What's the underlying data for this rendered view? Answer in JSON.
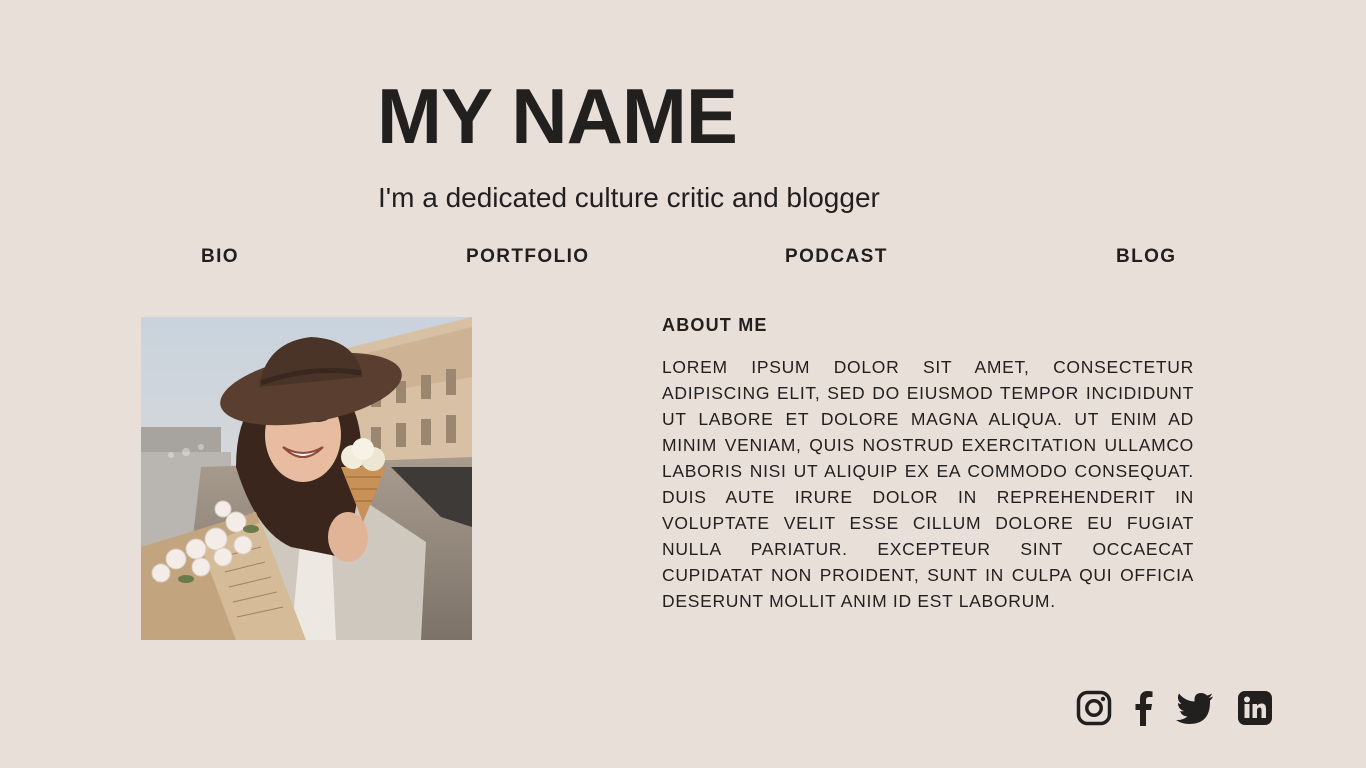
{
  "header": {
    "name": "MY NAME",
    "tagline": "I'm a dedicated culture critic and blogger"
  },
  "nav": {
    "items": [
      {
        "label": "BIO"
      },
      {
        "label": "PORTFOLIO"
      },
      {
        "label": "PODCAST"
      },
      {
        "label": "BLOG"
      }
    ]
  },
  "profile_photo": {
    "subject": "smiling woman in a brown wide-brim hat holding a flower bouquet and an ice cream cone on a city street"
  },
  "about": {
    "heading": "ABOUT ME",
    "body": "LOREM IPSUM DOLOR SIT AMET, CONSECTETUR ADIPISCING ELIT, SED DO EIUSMOD TEMPOR INCIDIDUNT UT LABORE ET DOLORE MAGNA ALIQUA. UT ENIM AD MINIM VENIAM, QUIS NOSTRUD EXERCITATION ULLAMCO LABORIS NISI UT ALIQUIP EX EA COMMODO CONSEQUAT. DUIS AUTE IRURE DOLOR IN REPREHENDERIT IN VOLUPTATE VELIT ESSE CILLUM DOLORE EU FUGIAT NULLA PARIATUR. EXCEPTEUR SINT OCCAECAT CUPIDATAT NON PROIDENT, SUNT IN CULPA QUI OFFICIA DESERUNT MOLLIT ANIM ID EST LABORUM."
  },
  "social": {
    "icons": [
      "instagram-icon",
      "facebook-icon",
      "twitter-icon",
      "linkedin-icon"
    ]
  },
  "colors": {
    "background": "#e8dfd9",
    "text": "#221f1f"
  }
}
